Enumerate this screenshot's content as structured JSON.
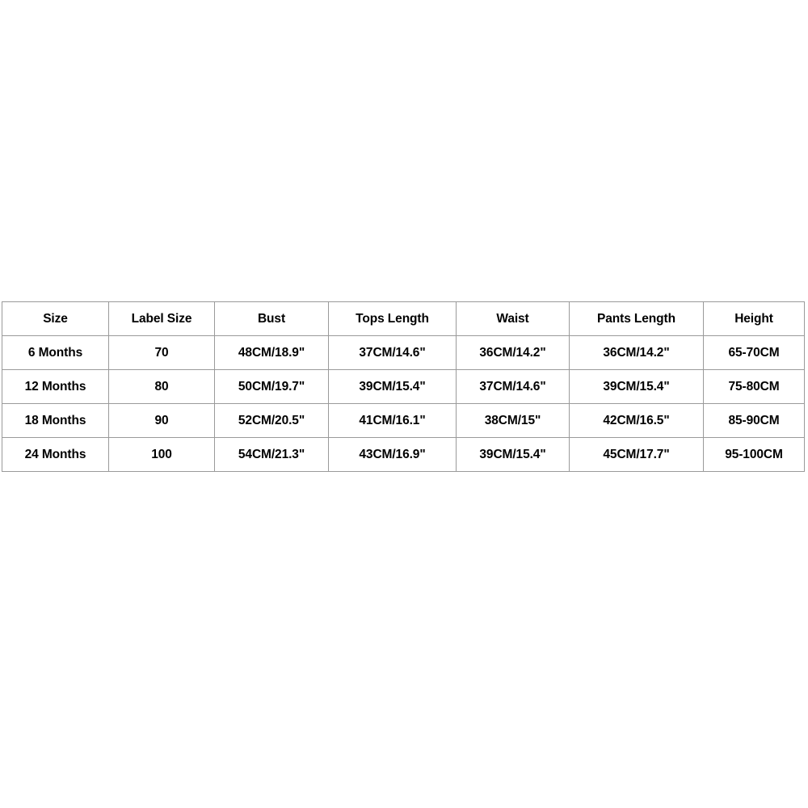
{
  "table": {
    "name": "baby-clothing-size-chart",
    "columns": [
      "Size",
      "Label Size",
      "Bust",
      "Tops Length",
      "Waist",
      "Pants Length",
      "Height"
    ],
    "rows": [
      {
        "size": "6 Months",
        "label_size": "70",
        "bust": "48CM/18.9\"",
        "tops_length": "37CM/14.6\"",
        "waist": "36CM/14.2\"",
        "pants_length": "36CM/14.2\"",
        "height": "65-70CM"
      },
      {
        "size": "12 Months",
        "label_size": "80",
        "bust": "50CM/19.7\"",
        "tops_length": "39CM/15.4\"",
        "waist": "37CM/14.6\"",
        "pants_length": "39CM/15.4\"",
        "height": "75-80CM"
      },
      {
        "size": "18 Months",
        "label_size": "90",
        "bust": "52CM/20.5\"",
        "tops_length": "41CM/16.1\"",
        "waist": "38CM/15\"",
        "pants_length": "42CM/16.5\"",
        "height": "85-90CM"
      },
      {
        "size": "24 Months",
        "label_size": "100",
        "bust": "54CM/21.3\"",
        "tops_length": "43CM/16.9\"",
        "waist": "39CM/15.4\"",
        "pants_length": "45CM/17.7\"",
        "height": "95-100CM"
      }
    ]
  },
  "colors": {
    "page_background": "#ffffff",
    "cell_background": "#ffffff",
    "border": "#9a9a9a",
    "text": "#000000"
  }
}
